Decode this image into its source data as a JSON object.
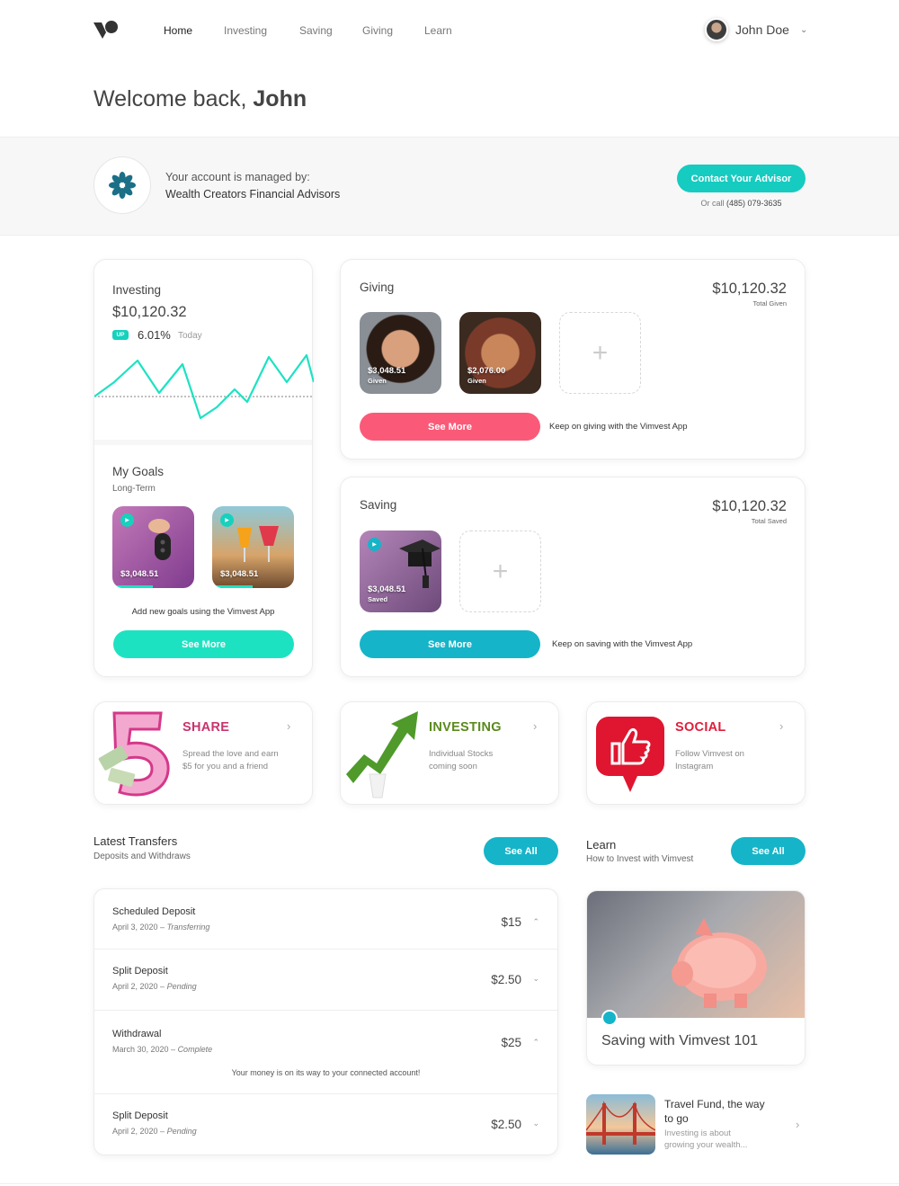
{
  "nav": {
    "items": [
      "Home",
      "Investing",
      "Saving",
      "Giving",
      "Learn"
    ]
  },
  "user": {
    "name": "John Doe"
  },
  "welcome": {
    "prefix": "Welcome back,",
    "name": "John"
  },
  "advisor": {
    "managed_label": "Your account is managed by:",
    "firm": "Wealth Creators Financial Advisors",
    "contact_button": "Contact Your Advisor",
    "or_call": "Or call",
    "phone": "(485) 079-3635"
  },
  "investing": {
    "title": "Investing",
    "amount": "$10,120.32",
    "badge": "UP",
    "change": "6.01%",
    "period": "Today"
  },
  "goals": {
    "title": "My Goals",
    "subtitle": "Long-Term",
    "items": [
      {
        "amount": "$3,048.51"
      },
      {
        "amount": "$3,048.51"
      }
    ],
    "hint": "Add new goals using the Vimvest App",
    "button": "See More"
  },
  "giving": {
    "title": "Giving",
    "amount": "$10,120.32",
    "amount_label": "Total Given",
    "items": [
      {
        "amount": "$3,048.51",
        "label": "Given"
      },
      {
        "amount": "$2,076.00",
        "label": "Given"
      }
    ],
    "button": "See More",
    "hint": "Keep on giving with the Vimvest App"
  },
  "saving": {
    "title": "Saving",
    "amount": "$10,120.32",
    "amount_label": "Total Saved",
    "items": [
      {
        "amount": "$3,048.51",
        "label": "Saved"
      }
    ],
    "button": "See More",
    "hint": "Keep on saving with the Vimvest App"
  },
  "promos": [
    {
      "title": "SHARE",
      "line1": "Spread the love and earn",
      "line2": "$5 for you and a friend",
      "color": "#c8356e"
    },
    {
      "title": "INVESTING",
      "line1": "Individual Stocks",
      "line2": "coming soon",
      "color": "#5b8a1e"
    },
    {
      "title": "SOCIAL",
      "line1": "Follow Vimvest on",
      "line2": "Instagram",
      "color": "#e01e3c"
    }
  ],
  "transfers": {
    "title": "Latest Transfers",
    "subtitle": "Deposits and Withdraws",
    "see_all": "See All",
    "rows": [
      {
        "title": "Scheduled Deposit",
        "date": "April 3, 2020 –",
        "status": "Transferring",
        "amount": "$15",
        "expanded": true
      },
      {
        "title": "Split Deposit",
        "date": "April 2, 2020 –",
        "status": "Pending",
        "amount": "$2.50",
        "expanded": false
      },
      {
        "title": "Withdrawal",
        "date": "March 30, 2020 –",
        "status": "Complete",
        "amount": "$25",
        "expanded": true,
        "note": "Your money is on its way to your connected account!"
      },
      {
        "title": "Split Deposit",
        "date": "April 2, 2020 –",
        "status": "Pending",
        "amount": "$2.50",
        "expanded": false
      }
    ]
  },
  "learn": {
    "title": "Learn",
    "subtitle": "How to Invest with Vimvest",
    "see_all": "See All",
    "feature_title": "Saving with Vimvest 101",
    "article": {
      "title_line1": "Travel Fund, the way",
      "title_line2": "to go",
      "desc_line1": "Investing is about",
      "desc_line2": "growing your wealth..."
    }
  },
  "colors": {
    "teal": "#16cbc0",
    "pink": "#fa5a78",
    "blue": "#16b4c8",
    "green": "#1de2c2"
  }
}
